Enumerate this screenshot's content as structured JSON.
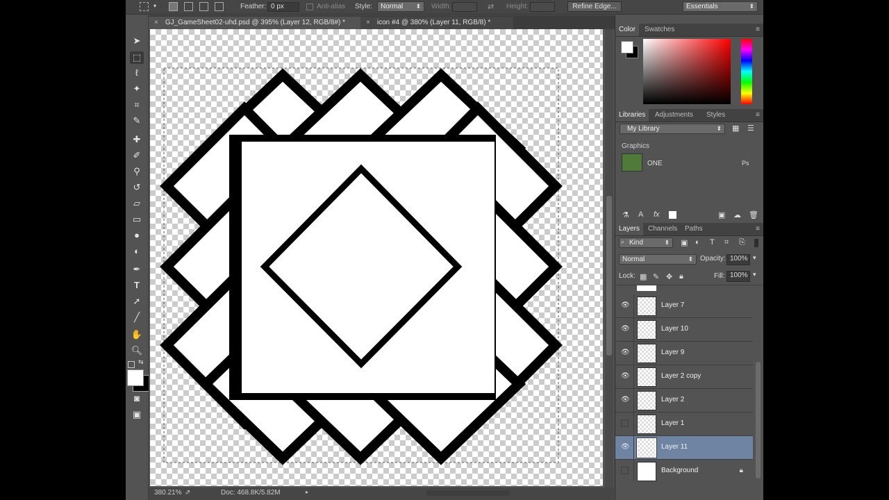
{
  "options_bar": {
    "feather_label": "Feather:",
    "feather_value": "0 px",
    "antialias_label": "Anti-alias",
    "style_label": "Style:",
    "style_value": "Normal",
    "width_label": "Width:",
    "height_label": "Height:",
    "refine_edge": "Refine Edge...",
    "workspace": "Essentials"
  },
  "tabs": [
    {
      "close": "×",
      "label": "GJ_GameSheet02-uhd.psd @ 395% (Layer 12, RGB/8#) *"
    },
    {
      "close": "×",
      "label": "icon #4 @ 380% (Layer 11, RGB/8) *"
    }
  ],
  "status_bar": {
    "zoom": "380.21%",
    "doc": "Doc: 468.8K/5.82M"
  },
  "color_panel": {
    "tabs": [
      "Color",
      "Swatches"
    ],
    "foreground": "#ffffff",
    "background": "#000000"
  },
  "libraries_panel": {
    "tabs": [
      "Libraries",
      "Adjustments",
      "Styles"
    ],
    "library": "My Library",
    "section": "Graphics",
    "item_name": "ONE",
    "item_badge": "Ps"
  },
  "layers_panel": {
    "tabs": [
      "Layers",
      "Channels",
      "Paths"
    ],
    "filter": "Kind",
    "blend_mode": "Normal",
    "opacity_label": "Opacity:",
    "opacity": "100%",
    "lock_label": "Lock:",
    "fill_label": "Fill:",
    "fill": "100%",
    "layers": [
      {
        "name": "Layer 7",
        "visible": true
      },
      {
        "name": "Layer 10",
        "visible": true
      },
      {
        "name": "Layer 9",
        "visible": true
      },
      {
        "name": "Layer 2 copy",
        "visible": true
      },
      {
        "name": "Layer 2",
        "visible": true
      },
      {
        "name": "Layer 1",
        "visible": false
      },
      {
        "name": "Layer 11",
        "visible": true,
        "selected": true
      },
      {
        "name": "Background",
        "visible": false,
        "locked": true
      }
    ]
  },
  "colors": {
    "selected_layer": "#6f84a3",
    "ui_bg": "#535353"
  }
}
